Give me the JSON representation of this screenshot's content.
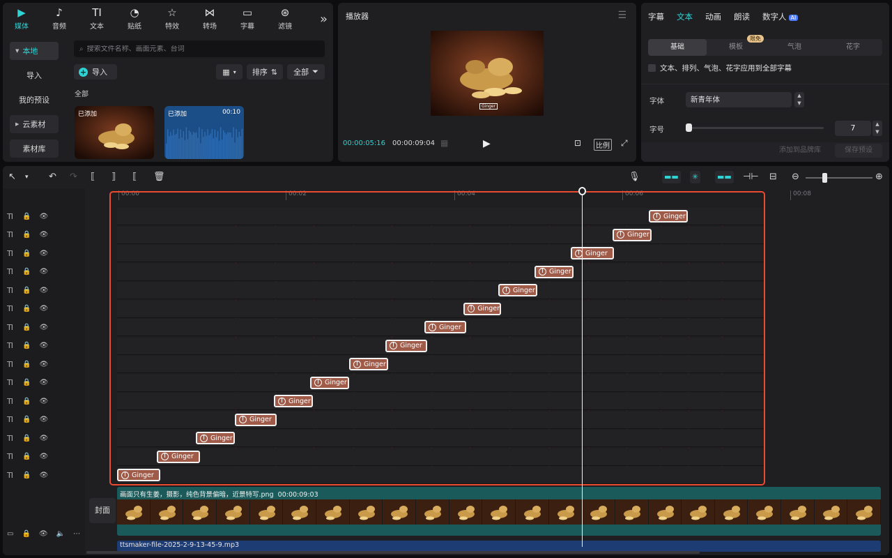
{
  "media": {
    "tabs": [
      {
        "label": "媒体",
        "icon": "media-icon"
      },
      {
        "label": "音频",
        "icon": "audio-icon"
      },
      {
        "label": "文本",
        "icon": "text-icon"
      },
      {
        "label": "贴纸",
        "icon": "sticker-icon"
      },
      {
        "label": "特效",
        "icon": "effects-icon"
      },
      {
        "label": "转场",
        "icon": "transition-icon"
      },
      {
        "label": "字幕",
        "icon": "subtitle-icon"
      },
      {
        "label": "滤镜",
        "icon": "filter-icon"
      }
    ],
    "nav": [
      "本地",
      "导入",
      "我的预设",
      "云素材",
      "素材库"
    ],
    "search_placeholder": "搜索文件名称、画面元素、台词",
    "import_label": "导入",
    "sort_label": "排序",
    "filter_label": "全部",
    "section_label": "全部",
    "items": [
      {
        "tag": "已添加",
        "duration": ""
      },
      {
        "tag": "已添加",
        "duration": "00:10"
      }
    ]
  },
  "player": {
    "title": "播放器",
    "current_time": "00:00:05:16",
    "total_time": "00:00:09:04",
    "ratio_label": "比例",
    "caption": "Ginger"
  },
  "textpanel": {
    "tabs": [
      "字幕",
      "文本",
      "动画",
      "朗读",
      "数字人"
    ],
    "ai_badge": "AI",
    "subtabs": [
      "基础",
      "模板",
      "气泡",
      "花字"
    ],
    "limit_badge": "限免",
    "apply_all": "文本、排列、气泡、花字应用到全部字幕",
    "font_label": "字体",
    "font_value": "新青年体",
    "size_label": "字号",
    "size_value": "7",
    "btn_brand": "添加到品牌库",
    "btn_preset": "保存预设"
  },
  "timeline": {
    "ruler": [
      "00:00",
      "00:02",
      "00:04",
      "00:06",
      "00:08"
    ],
    "clip_label": "Ginger",
    "cover_label": "封面",
    "video_clip": "画面只有生姜，摄影，纯色背景偏暗，近景特写.png",
    "video_duration": "00:00:09:03",
    "audio_clip": "ttsmaker-file-2025-2-9-13-45-9.mp3"
  },
  "colors": {
    "accent": "#2fd3d3",
    "selection": "#ea4b31",
    "text_clip": "#a05a48",
    "video_track": "#1a5a5a",
    "audio_track": "#1e3c74"
  }
}
